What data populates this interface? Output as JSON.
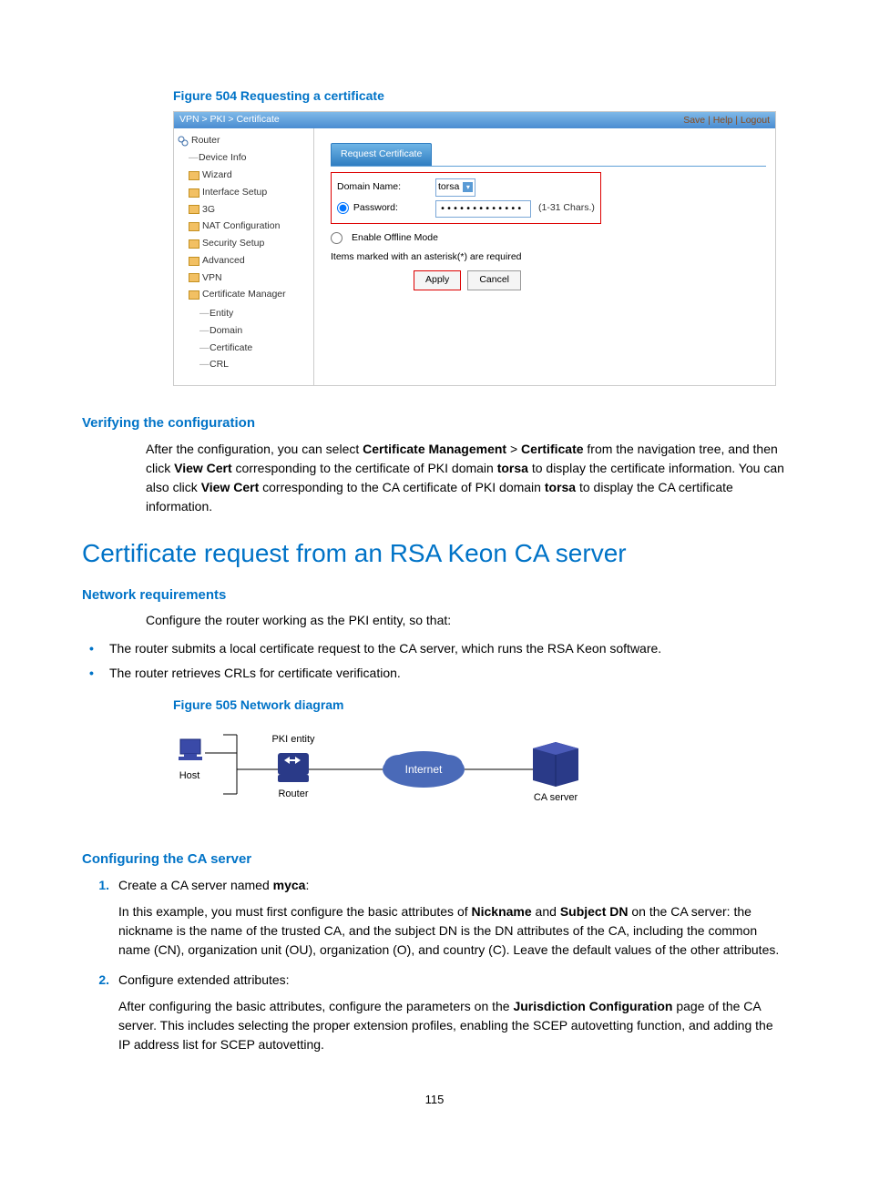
{
  "figure_504_caption": "Figure 504 Requesting a certificate",
  "figure_505_caption": "Figure 505 Network diagram",
  "screenshot": {
    "breadcrumb": "VPN > PKI > Certificate",
    "header_links": "Save | Help | Logout",
    "tree": {
      "root": "Router",
      "items": [
        "Device Info",
        "Wizard",
        "Interface Setup",
        "3G",
        "NAT Configuration",
        "Security Setup",
        "Advanced",
        "VPN",
        "Certificate Manager"
      ],
      "subitems": [
        "Entity",
        "Domain",
        "Certificate",
        "CRL"
      ]
    },
    "tab_label": "Request Certificate",
    "domain_label": "Domain Name:",
    "domain_value": "torsa",
    "password_label": "Password:",
    "password_mask": "•••••••••••••",
    "password_hint": "(1-31 Chars.)",
    "offline_label": "Enable Offline Mode",
    "required_note": "Items marked with an asterisk(*) are required",
    "apply": "Apply",
    "cancel": "Cancel"
  },
  "verify_heading": "Verifying the configuration",
  "verify_para": {
    "pre": "After the configuration, you can select ",
    "b1": "Certificate Management",
    "gt": " > ",
    "b2": "Certificate",
    "mid1": " from the navigation tree, and then click ",
    "b3": "View Cert",
    "mid2": " corresponding to the certificate of PKI domain ",
    "b4": "torsa",
    "mid3": " to display the certificate information. You can also click ",
    "b5": "View Cert",
    "mid4": " corresponding to the CA certificate of PKI domain ",
    "b6": "torsa",
    "end": " to display the CA certificate information."
  },
  "main_heading": "Certificate request from an RSA Keon CA server",
  "network_req_heading": "Network requirements",
  "network_intro": "Configure the router working as the PKI entity, so that:",
  "network_bullets": [
    "The router submits a local certificate request to the CA server, which runs the RSA Keon software.",
    "The router retrieves CRLs for certificate verification."
  ],
  "diagram": {
    "host": "Host",
    "pki_entity": "PKI entity",
    "router": "Router",
    "internet": "Internet",
    "ca_server": "CA server"
  },
  "config_ca_heading": "Configuring the CA server",
  "steps": {
    "s1_lead": "Create a CA server named ",
    "s1_bold": "myca",
    "s1_colon": ":",
    "s1_para": {
      "pre": "In this example, you must first configure the basic attributes of ",
      "b1": "Nickname",
      "and": " and ",
      "b2": "Subject DN",
      "rest": " on the CA server: the nickname is the name of the trusted CA, and the subject DN is the DN attributes of the CA, including the common name (CN), organization unit (OU), organization (O), and country (C). Leave the default values of the other attributes."
    },
    "s2_lead": "Configure extended attributes:",
    "s2_para": {
      "pre": "After configuring the basic attributes, configure the parameters on the ",
      "b1": "Jurisdiction Configuration",
      "rest": " page of the CA server. This includes selecting the proper extension profiles, enabling the SCEP autovetting function, and adding the IP address list for SCEP autovetting."
    }
  },
  "page_number": "115"
}
